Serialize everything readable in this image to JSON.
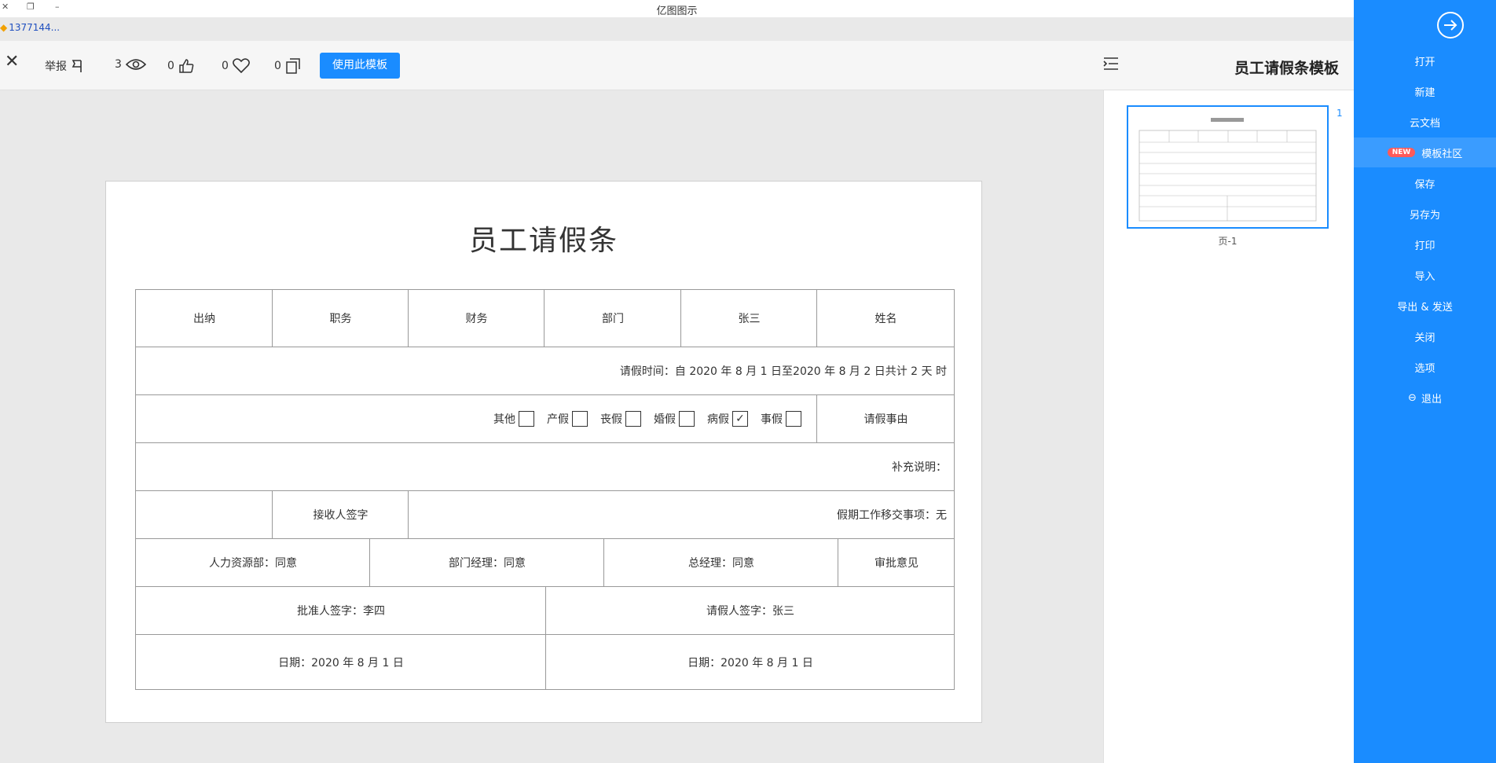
{
  "app": {
    "title": "亿图图示"
  },
  "user": {
    "name": "1377144..."
  },
  "toolbar": {
    "report": "举报",
    "views": "3",
    "likes": "0",
    "favorites": "0",
    "copies": "0",
    "use_template": "使用此模板"
  },
  "document": {
    "title": "员工请假条模板"
  },
  "form": {
    "title": "员工请假条",
    "row1": [
      "出纳",
      "职务",
      "财务",
      "部门",
      "张三",
      "姓名"
    ],
    "leave_time": "请假时间：自 2020 年 8 月 1 日至2020 年 8 月 2 日共计 2 天 时",
    "reason_label": "请假事由",
    "reasons": [
      "事假",
      "病假",
      "婚假",
      "丧假",
      "产假",
      "其他"
    ],
    "reason_checked": "病假",
    "supplement": "补充说明：",
    "handover": "假期工作移交事项：无",
    "receiver": "接收人签字",
    "approval_label": "审批意见",
    "gm": "总经理：同意",
    "dept_mgr": "部门经理：同意",
    "hr": "人力资源部：同意",
    "applicant_sig": "请假人签字：张三",
    "approver_sig": "批准人签字：李四",
    "date_left": "日期：2020 年 8 月 1 日",
    "date_right": "日期：2020 年 8 月 1 日"
  },
  "pages": {
    "number": "1",
    "label": "页-1"
  },
  "sidebar": {
    "items": [
      "打开",
      "新建",
      "云文档",
      "模板社区",
      "保存",
      "另存为",
      "打印",
      "导入",
      "导出 & 发送",
      "关闭",
      "选项",
      "退出"
    ],
    "new_badge": "NEW",
    "active": "模板社区"
  },
  "colors": {
    "accent": "#1a8cff",
    "sidebar": "#1a8cff",
    "badge": "#ff5a5a"
  }
}
